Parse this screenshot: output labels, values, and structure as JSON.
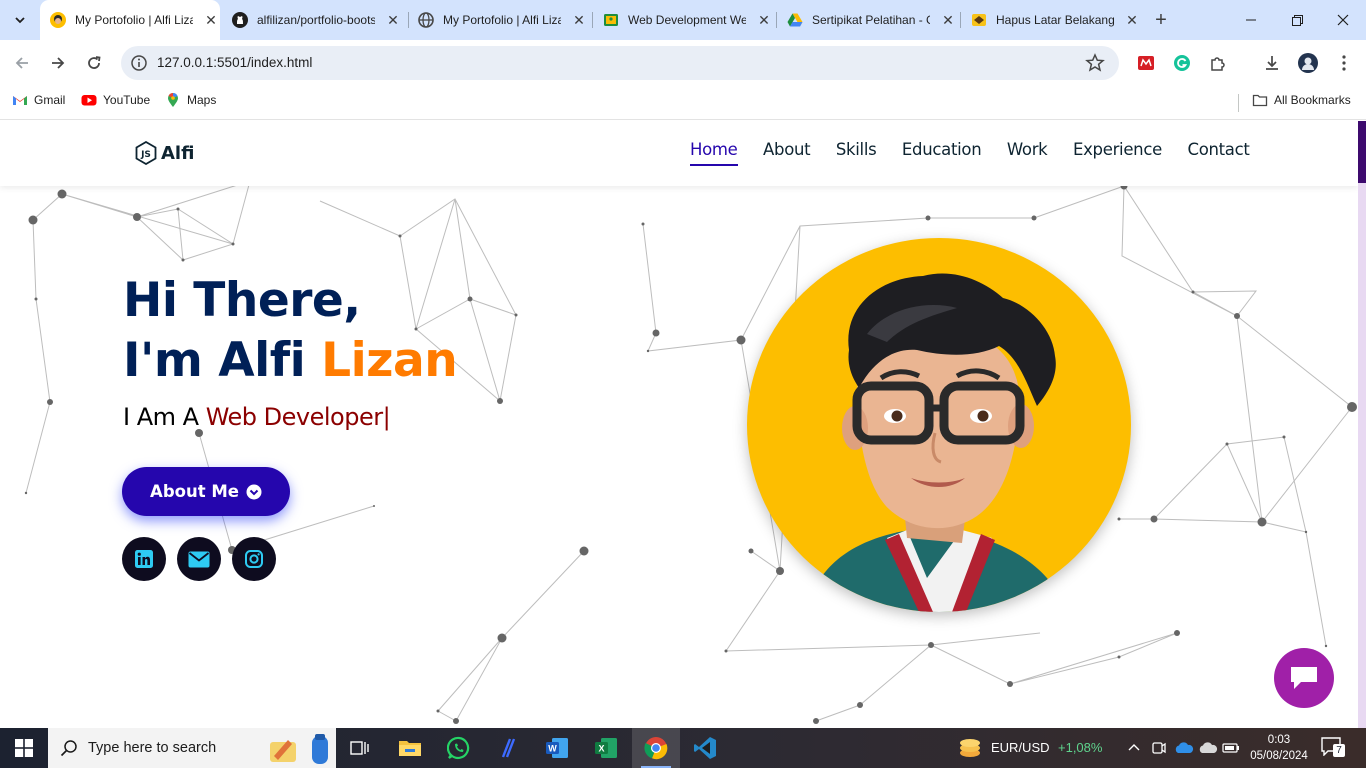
{
  "browser": {
    "tabs": [
      {
        "title": "My Portofolio | Alfi Lizan",
        "icon": "avatar-favicon",
        "active": true
      },
      {
        "title": "alfilizan/portfolio-bootstrap",
        "icon": "github-icon"
      },
      {
        "title": "My Portofolio | Alfi Lizan",
        "icon": "globe-icon"
      },
      {
        "title": "Web Development Week",
        "icon": "classroom-icon"
      },
      {
        "title": "Sertipikat Pelatihan - Google Drive",
        "icon": "drive-icon"
      },
      {
        "title": "Hapus Latar Belakang",
        "icon": "remove-bg-icon"
      }
    ],
    "url": "127.0.0.1:5501/index.html",
    "bookmarks": [
      {
        "label": "Gmail",
        "icon": "gmail-icon"
      },
      {
        "label": "YouTube",
        "icon": "youtube-icon"
      },
      {
        "label": "Maps",
        "icon": "maps-icon"
      }
    ],
    "all_bookmarks": "All Bookmarks"
  },
  "site": {
    "logo_text": "Alfi",
    "nav": [
      {
        "label": "Home",
        "active": true
      },
      {
        "label": "About"
      },
      {
        "label": "Skills"
      },
      {
        "label": "Education"
      },
      {
        "label": "Work"
      },
      {
        "label": "Experience"
      },
      {
        "label": "Contact"
      }
    ],
    "hero": {
      "line1": "Hi There,",
      "line2_prefix": "I'm Alfi ",
      "line2_accent": "Lizan",
      "typed_prefix": "I Am A ",
      "typed_role": "Web Developer|",
      "button_label": "About Me"
    },
    "socials": [
      "linkedin-icon",
      "email-icon",
      "instagram-icon"
    ],
    "colors": {
      "primary": "#2506ad",
      "heading": "#002057",
      "accent": "#ff7b00",
      "role": "#8b0000",
      "avatar_bg": "#fdbe00",
      "chat_fab": "#a020a8"
    }
  },
  "taskbar": {
    "search_placeholder": "Type here to search",
    "ticker_label": "EUR/USD",
    "ticker_change": "+1,08%",
    "time": "0:03",
    "date": "05/08/2024",
    "notifications": "7"
  }
}
